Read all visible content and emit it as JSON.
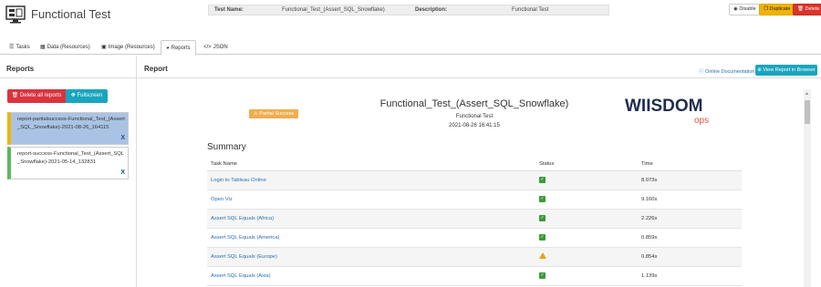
{
  "app": {
    "title": "Functional Test"
  },
  "info": {
    "test_name_label": "Test Name:",
    "test_name_value": "Functional_Test_(Assert_SQL_Snowflake)",
    "description_label": "Description:",
    "description_value": "Functional Test"
  },
  "header_buttons": {
    "disable": "Disable",
    "duplicate": "Duplicate",
    "delete": "Delete"
  },
  "tabs": [
    {
      "label": "Tasks",
      "icon": "list-icon"
    },
    {
      "label": "Data (Resources)",
      "icon": "table-icon"
    },
    {
      "label": "Image (Resources)",
      "icon": "image-icon"
    },
    {
      "label": "Reports",
      "icon": "pie-chart-icon",
      "active": true
    },
    {
      "label": "JSON",
      "icon": "code-icon"
    }
  ],
  "left": {
    "title": "Reports",
    "delete_all": "Delete all reports",
    "fullscreen": "Fullscreen",
    "reports": [
      {
        "name": "report-partialsuccess-Functional_Test_(Assert_SQL_Snowflake)-2021-08-26_164115",
        "close": "X"
      },
      {
        "name": "report-success-Functional_Test_(Assert_SQL_Snowflake)-2021-05-14_132831",
        "close": "X"
      }
    ]
  },
  "main": {
    "title": "Report",
    "online_doc": "Online Documentation",
    "view_report": "View Report in Browser"
  },
  "report": {
    "status": "Partial Success",
    "title": "Functional_Test_(Assert_SQL_Snowflake)",
    "subtitle": "Functional Test",
    "date": "2021-08-26 16:41:15",
    "brand_text": "WIISDOM",
    "brand_sub": "ops",
    "summary": "Summary",
    "columns": {
      "task": "Task Name",
      "status": "Status",
      "time": "Time"
    },
    "rows": [
      {
        "task": "Login to Tableau Online",
        "status": "ok",
        "time": "8.073s"
      },
      {
        "task": "Open Viz",
        "status": "ok",
        "time": "9.160s"
      },
      {
        "task": "Assert SQL Equals (Africa)",
        "status": "ok",
        "time": "2.226s"
      },
      {
        "task": "Assert SQL Equals (America)",
        "status": "ok",
        "time": "0.859s"
      },
      {
        "task": "Assert SQL Equals (Europe)",
        "status": "warn",
        "time": "0.854s"
      },
      {
        "task": "Assert SQL Equals (Asia)",
        "status": "ok",
        "time": "1.139s"
      }
    ]
  },
  "colors": {
    "accent": "#19a5bd",
    "danger": "#d9342b",
    "warning": "#f0b400",
    "success": "#3a9b35"
  }
}
